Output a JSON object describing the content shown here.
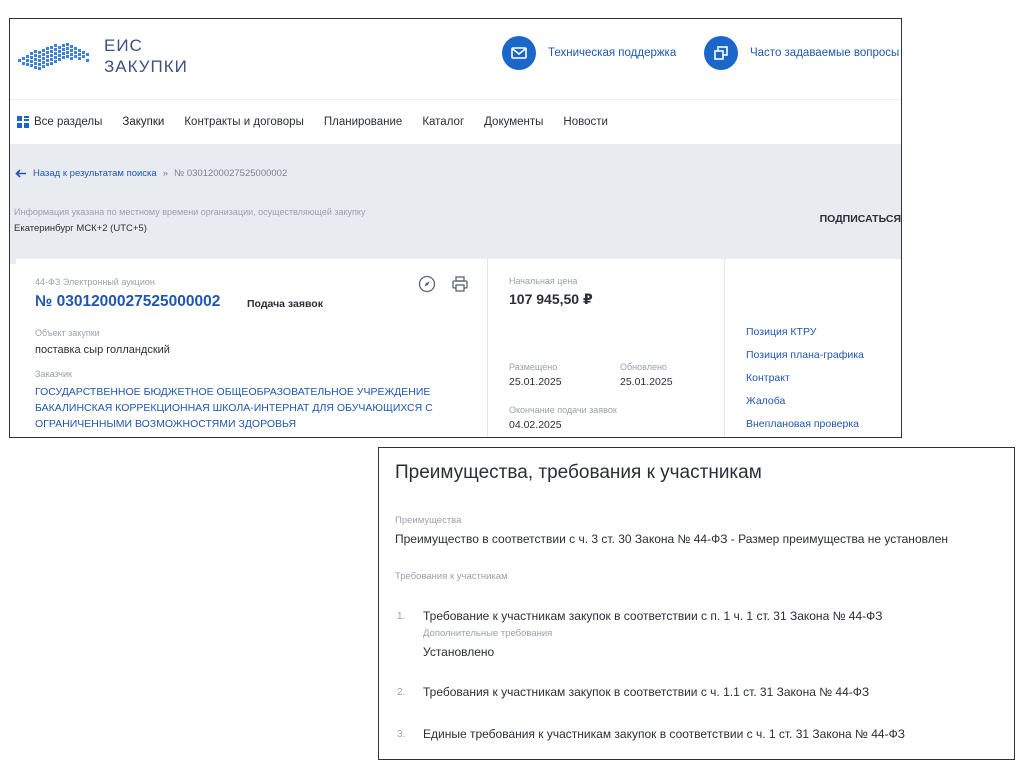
{
  "header": {
    "logo_line1": "ЕИС",
    "logo_line2": "ЗАКУПКИ",
    "support_label": "Техническая поддержка",
    "faq_label": "Часто задаваемые вопросы"
  },
  "nav": {
    "items": [
      "Все разделы",
      "Закупки",
      "Контракты и договоры",
      "Планирование",
      "Каталог",
      "Документы",
      "Новости"
    ]
  },
  "breadcrumb": {
    "back_label": "Назад к результатам поиска",
    "separator": "»",
    "current": "№ 0301200027525000002"
  },
  "info": {
    "note": "Информация указана по местному времени организации, осуществляющей закупку",
    "timezone": "Екатеринбург МСК+2 (UTC+5)",
    "subscribe_label": "ПОДПИСАТЬСЯ"
  },
  "purchase": {
    "type": "44-ФЗ Электронный аукцион",
    "reg_number": "№ 0301200027525000002",
    "stage": "Подача заявок",
    "object_label": "Объект закупки",
    "object_value": "поставка сыр голландский",
    "customer_label": "Заказчик",
    "customer_value": "ГОСУДАРСТВЕННОЕ БЮДЖЕТНОЕ ОБЩЕОБРАЗОВАТЕЛЬНОЕ УЧРЕЖДЕНИЕ БАКАЛИНСКАЯ КОРРЕКЦИОННАЯ ШКОЛА-ИНТЕРНАТ ДЛЯ ОБУЧАЮЩИХСЯ С ОГРАНИЧЕННЫМИ ВОЗМОЖНОСТЯМИ ЗДОРОВЬЯ",
    "price_label": "Начальная цена",
    "price_value": "107 945,50 ₽",
    "posted_label": "Размещено",
    "posted_value": "25.01.2025",
    "updated_label": "Обновлено",
    "updated_value": "25.01.2025",
    "deadline_label": "Окончание подачи заявок",
    "deadline_value": "04.02.2025"
  },
  "side_links": [
    "Позиция КТРУ",
    "Позиция плана-графика",
    "Контракт",
    "Жалоба",
    "Внеплановая проверка"
  ],
  "requirements": {
    "title": "Преимущества, требования к участникам",
    "advantages_label": "Преимущества",
    "advantages_value": "Преимущество в соответствии с ч. 3 ст. 30 Закона № 44-ФЗ - Размер преимущества не установлен",
    "participants_label": "Требования к участникам",
    "items": [
      {
        "num": "1.",
        "text": "Требование к участникам закупок в соответствии с п. 1 ч. 1 ст. 31 Закона № 44-ФЗ",
        "extra_label": "Дополнительные требования",
        "extra_value": "Установлено"
      },
      {
        "num": "2.",
        "text": "Требования к участникам закупок в соответствии с ч. 1.1 ст. 31 Закона № 44-ФЗ"
      },
      {
        "num": "3.",
        "text": "Единые требования к участникам закупок в соответствии с ч. 1 ст. 31 Закона № 44-ФЗ"
      }
    ]
  },
  "colors": {
    "accent_blue": "#1a66c9",
    "link_blue": "#1f57b0",
    "band_grey": "#e8ebf0",
    "logo_blue": "#3b5283"
  },
  "icons": [
    "russia-map-logo-icon",
    "mail-icon",
    "windows-icon",
    "grid-icon",
    "arrow-left-icon",
    "compass-icon",
    "print-icon"
  ]
}
